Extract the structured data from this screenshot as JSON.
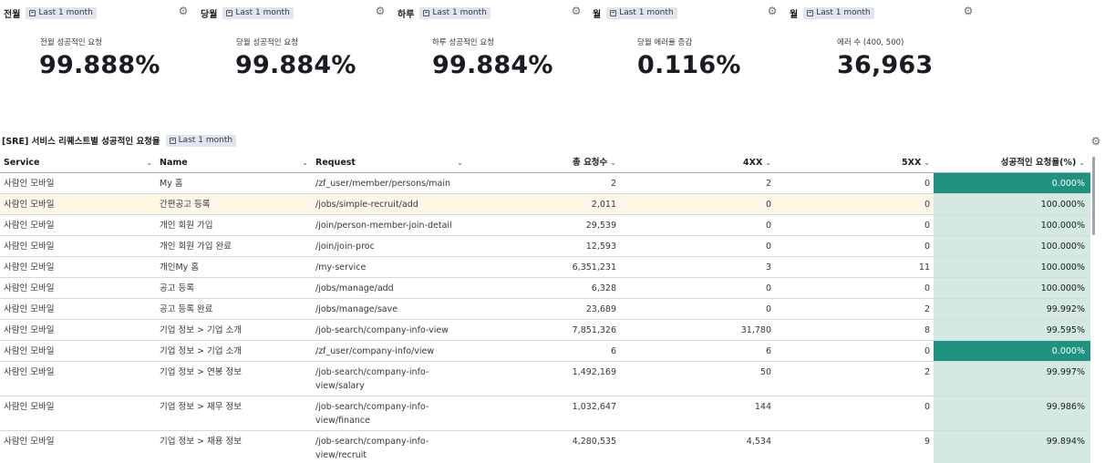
{
  "panels": [
    {
      "title": "전월",
      "time": "Last 1 month",
      "label": "전월 성공적인 요청",
      "value": "99.888%"
    },
    {
      "title": "당월",
      "time": "Last 1 month",
      "label": "당월 성공적인 요청",
      "value": "99.884%"
    },
    {
      "title": "하루",
      "time": "Last 1 month",
      "label": "하루 성공적인 요청",
      "value": "99.884%"
    },
    {
      "title": "월",
      "time": "Last 1 month",
      "label": "당월 에러율 증감",
      "value": "0.116%"
    },
    {
      "title": "월",
      "time": "Last 1 month",
      "label": "에러 수 (400, 500)",
      "value": "36,963"
    }
  ],
  "table": {
    "title": "[SRE] 서비스 리퀘스트별 성공적인 요청율",
    "time": "Last 1 month",
    "columns": {
      "service": "Service",
      "name": "Name",
      "request": "Request",
      "total": "총 요청수",
      "c4xx": "4XX",
      "c5xx": "5XX",
      "rate": "성공적인 요청율(%)"
    },
    "rows": [
      {
        "service": "사람인 모바일",
        "name": "My 홈",
        "request": "/zf_user/member/persons/main",
        "total": "2",
        "c4xx": "2",
        "c5xx": "0",
        "rate": "0.000%"
      },
      {
        "service": "사람인 모바일",
        "name": "간편공고 등록",
        "request": "/jobs/simple-recruit/add",
        "total": "2,011",
        "c4xx": "0",
        "c5xx": "0",
        "rate": "100.000%"
      },
      {
        "service": "사람인 모바일",
        "name": "개인 회원 가입",
        "request": "/join/person-member-join-detail",
        "total": "29,539",
        "c4xx": "0",
        "c5xx": "0",
        "rate": "100.000%"
      },
      {
        "service": "사람인 모바일",
        "name": "개인 회원 가입 완료",
        "request": "/join/join-proc",
        "total": "12,593",
        "c4xx": "0",
        "c5xx": "0",
        "rate": "100.000%"
      },
      {
        "service": "사람인 모바일",
        "name": "개인My 홈",
        "request": "/my-service",
        "total": "6,351,231",
        "c4xx": "3",
        "c5xx": "11",
        "rate": "100.000%"
      },
      {
        "service": "사람인 모바일",
        "name": "공고 등록",
        "request": "/jobs/manage/add",
        "total": "6,328",
        "c4xx": "0",
        "c5xx": "0",
        "rate": "100.000%"
      },
      {
        "service": "사람인 모바일",
        "name": "공고 등록 완료",
        "request": "/jobs/manage/save",
        "total": "23,689",
        "c4xx": "0",
        "c5xx": "2",
        "rate": "99.992%"
      },
      {
        "service": "사람인 모바일",
        "name": "기업 정보 > 기업 소개",
        "request": "/job-search/company-info-view",
        "total": "7,851,326",
        "c4xx": "31,780",
        "c5xx": "8",
        "rate": "99.595%"
      },
      {
        "service": "사람인 모바일",
        "name": "기업 정보 > 기업 소개",
        "request": "/zf_user/company-info/view",
        "total": "6",
        "c4xx": "6",
        "c5xx": "0",
        "rate": "0.000%"
      },
      {
        "service": "사람인 모바일",
        "name": "기업 정보 > 연봉 정보",
        "request": "/job-search/company-info-view/salary",
        "total": "1,492,169",
        "c4xx": "50",
        "c5xx": "2",
        "rate": "99.997%"
      },
      {
        "service": "사람인 모바일",
        "name": "기업 정보 > 재무 정보",
        "request": "/job-search/company-info-view/finance",
        "total": "1,032,647",
        "c4xx": "144",
        "c5xx": "0",
        "rate": "99.986%"
      },
      {
        "service": "사람인 모바일",
        "name": "기업 정보 > 채용 정보",
        "request": "/job-search/company-info-view/recruit",
        "total": "4,280,535",
        "c4xx": "4,534",
        "c5xx": "9",
        "rate": "99.894%"
      }
    ]
  },
  "colors": {
    "rate_high": "#d5e9e3",
    "rate_low": "#209280",
    "row_highlight": "#fdf7e6"
  },
  "icons": {
    "panel_menu": "gear-icon",
    "time_badge": "calendar-icon",
    "sort": "chevron-down-icon"
  }
}
